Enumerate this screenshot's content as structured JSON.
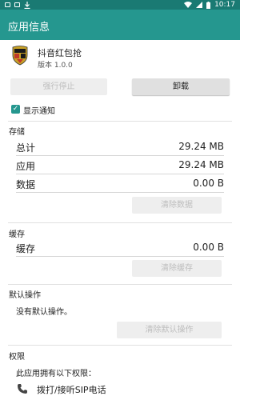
{
  "status_bar": {
    "time": "10:17"
  },
  "app_bar": {
    "title": "应用信息"
  },
  "app": {
    "name": "抖音红包抢",
    "version": "版本 1.0.0"
  },
  "buttons": {
    "force_stop": "强行停止",
    "uninstall": "卸载",
    "clear_data": "清除数据",
    "clear_cache": "清除缓存",
    "clear_defaults": "清除默认操作"
  },
  "notifications": {
    "label": "显示通知",
    "checked": true
  },
  "storage": {
    "title": "存储",
    "rows": [
      {
        "label": "总计",
        "value": "29.24 MB"
      },
      {
        "label": "应用",
        "value": "29.24 MB"
      },
      {
        "label": "数据",
        "value": "0.00 B"
      }
    ]
  },
  "cache": {
    "title": "缓存",
    "rows": [
      {
        "label": "缓存",
        "value": "0.00 B"
      }
    ]
  },
  "defaults": {
    "title": "默认操作",
    "text": "没有默认操作。"
  },
  "permissions": {
    "title": "权限",
    "intro": "此应用拥有以下权限：",
    "items": [
      {
        "icon": "phone-icon",
        "label": "拨打/接听SIP电话"
      }
    ]
  },
  "colors": {
    "status_bar": "#1a7a73",
    "app_bar": "#25978f",
    "accent": "#25978f"
  }
}
